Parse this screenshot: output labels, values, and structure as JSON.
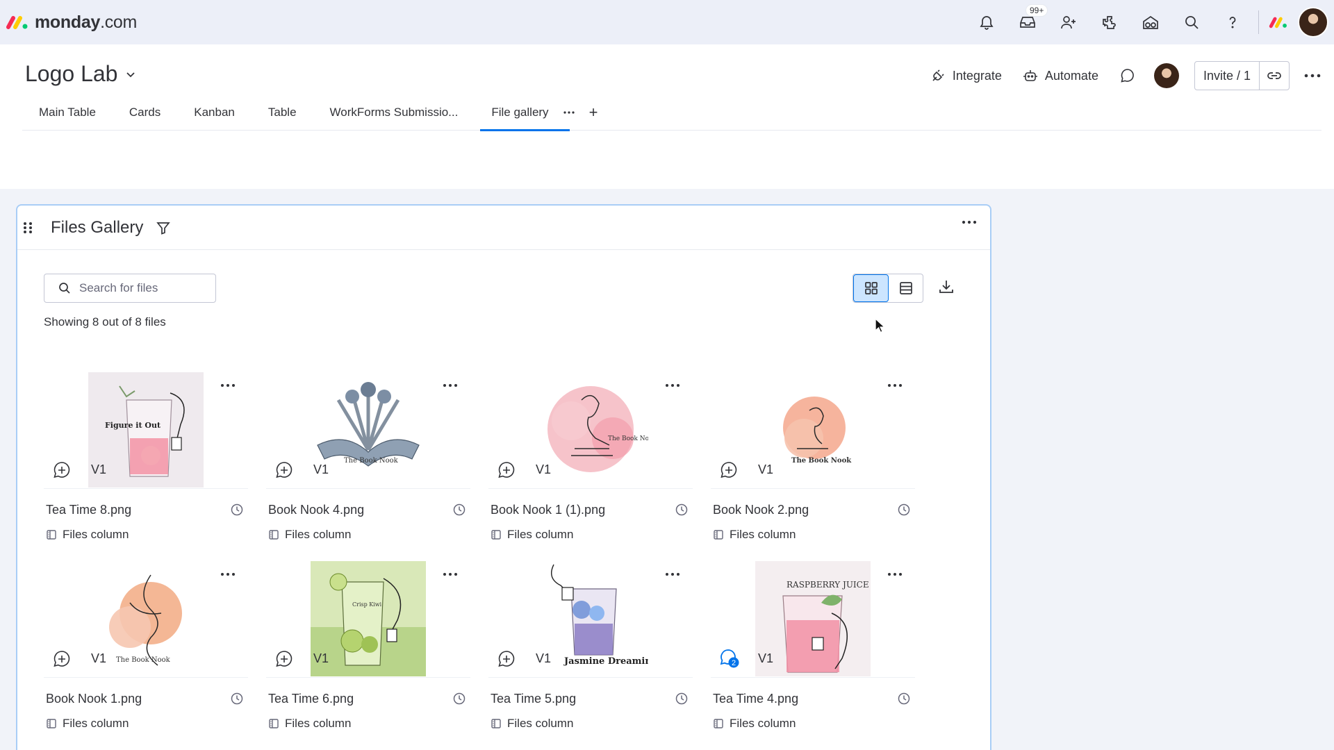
{
  "app": {
    "brand_name_bold": "monday",
    "brand_name_rest": ".com",
    "notification_badge": "99+",
    "top_icons": [
      "bell-icon",
      "inbox-icon",
      "invite-member-icon",
      "apps-icon",
      "marketplace-icon",
      "search-icon",
      "help-icon"
    ]
  },
  "board": {
    "title": "Logo Lab",
    "actions": {
      "integrate": "Integrate",
      "automate": "Automate",
      "invite": "Invite / 1"
    },
    "tabs": [
      {
        "label": "Main Table",
        "active": false
      },
      {
        "label": "Cards",
        "active": false
      },
      {
        "label": "Kanban",
        "active": false
      },
      {
        "label": "Table",
        "active": false
      },
      {
        "label": "WorkForms Submissio...",
        "active": false
      },
      {
        "label": "File gallery",
        "active": true
      }
    ],
    "tab_add": "+"
  },
  "gallery": {
    "title": "Files Gallery",
    "search_placeholder": "Search for files",
    "showing": "Showing 8 out of 8 files",
    "view_mode": "grid",
    "files": [
      {
        "name": "Tea Time 8.png",
        "version": "V1",
        "column": "Files column",
        "updates": 0,
        "art": "tea-pink"
      },
      {
        "name": "Book Nook 4.png",
        "version": "V1",
        "column": "Files column",
        "updates": 0,
        "art": "book-blue"
      },
      {
        "name": "Book Nook 1 (1).png",
        "version": "V1",
        "column": "Files column",
        "updates": 0,
        "art": "reader-pink"
      },
      {
        "name": "Book Nook 2.png",
        "version": "V1",
        "column": "Files column",
        "updates": 0,
        "art": "reader-peach"
      },
      {
        "name": "Book Nook 1.png",
        "version": "V1",
        "column": "Files column",
        "updates": 0,
        "art": "reader-orange"
      },
      {
        "name": "Tea Time 6.png",
        "version": "V1",
        "column": "Files column",
        "updates": 0,
        "art": "tea-green"
      },
      {
        "name": "Tea Time 5.png",
        "version": "V1",
        "column": "Files column",
        "updates": 0,
        "art": "tea-purple"
      },
      {
        "name": "Tea Time 4.png",
        "version": "V1",
        "column": "Files column",
        "updates": 2,
        "art": "tea-raspberry"
      }
    ],
    "art_text": {
      "tea-pink": "Figure it Out",
      "book-blue": "The Book Nook",
      "reader-pink": "The Book Nook",
      "reader-peach": "The Book Nook",
      "reader-orange": "The Book Nook",
      "tea-green": "Crisp Kiwi",
      "tea-purple": "Jasmine Dreaming",
      "tea-raspberry": "RASPBERRY JUICE"
    }
  },
  "colors": {
    "accent": "#0073ea",
    "selected_bg": "#cce5ff",
    "widget_border": "#a9cdf6"
  }
}
